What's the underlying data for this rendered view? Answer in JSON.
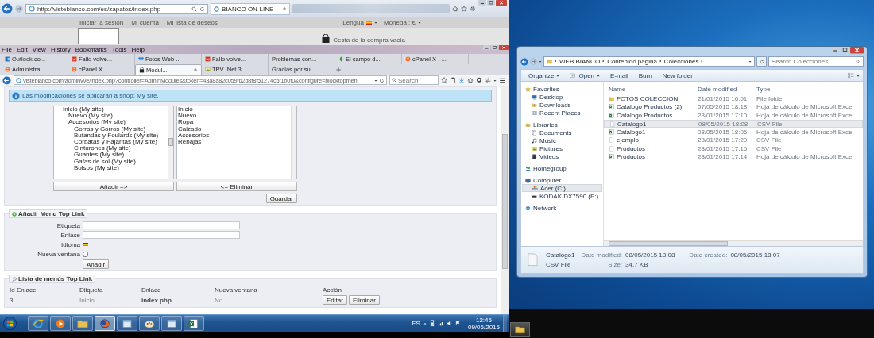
{
  "ie_window": {
    "address": "http://vistebianco.com/es/zapatos/index.php",
    "tab": "BIANCO ON-LINE",
    "links": [
      "Iniciar la sesión",
      "Mi cuenta",
      "Mi lista de deseos"
    ],
    "language_label": "Lengua",
    "currency": "Moneda : €",
    "cart": "Cesta de la compra vacía"
  },
  "firefox": {
    "menu": [
      "File",
      "Edit",
      "View",
      "History",
      "Bookmarks",
      "Tools",
      "Help"
    ],
    "tabs": [
      {
        "label": "Outlook.co...",
        "kind": "mail",
        "selected": false
      },
      {
        "label": "Fallo volve...",
        "kind": "tile",
        "selected": false
      },
      {
        "label": "Fotos Web ...",
        "kind": "box",
        "selected": false
      },
      {
        "label": "Fallo volve...",
        "kind": "tile",
        "selected": false
      },
      {
        "label": "Problemas con...",
        "selected": false
      },
      {
        "label": "El campo d...",
        "kind": "leaf",
        "selected": false
      },
      {
        "label": "cPanel X - ...",
        "kind": "panel",
        "selected": false
      },
      {
        "label": "Administra...",
        "kind": "panel",
        "selected": false
      },
      {
        "label": "cPanel X",
        "kind": "panel",
        "selected": false
      },
      {
        "label": "Modul...",
        "kind": "bag",
        "selected": true
      },
      {
        "label": "TPV .Net 3....",
        "kind": "picture",
        "selected": false
      },
      {
        "label": "Gracias por su ...",
        "selected": false
      }
    ],
    "url": "vistebianco.com/adminvve/index.php?controller=AdminModules&token=43a8a82c059f62d8f8f51274c5f1b0f0&configure=blocktopmen",
    "search_placeholder": "Search"
  },
  "page": {
    "notice": "Las modificaciones se aplicarán a shop: My site.",
    "category_tree": [
      {
        "label": "Inicio (My site)",
        "children": [
          {
            "label": "Nuevo (My site)"
          },
          {
            "label": "Accesorios (My site)",
            "children": [
              {
                "label": "Gorras y Gorros (My site)"
              },
              {
                "label": "Bufandas y Foulards (My site)"
              },
              {
                "label": "Corbatas y Pajaritas (My site)"
              },
              {
                "label": "Cinturones (My site)"
              },
              {
                "label": "Guantes (My site)"
              },
              {
                "label": "Gafas de sol (My site)"
              },
              {
                "label": "Bolsos (My site)"
              }
            ]
          }
        ]
      }
    ],
    "menu_items": [
      "Inicio",
      "Nuevo",
      "Ropa",
      "Calzado",
      "Accesorios",
      "Rebajas"
    ],
    "add_button": "Añadir =>",
    "remove_button": "<= Eliminar",
    "save_button": "Guardar",
    "add_panel": {
      "title": "Añadir Menu Top Link",
      "fields": [
        {
          "label": "Etiqueta",
          "kind": "text"
        },
        {
          "label": "Enlace",
          "kind": "text"
        },
        {
          "label": "Idioma",
          "kind": "flag"
        },
        {
          "label": "Nueva ventana",
          "kind": "checkbox",
          "checked": false
        }
      ],
      "button": "Añadir"
    },
    "list_panel": {
      "title": "Lista de menús Top Link",
      "columns": [
        "Id Enlace",
        "Etiqueta",
        "Enlace",
        "Nueva ventana",
        "Acción"
      ],
      "rows": [
        {
          "cells": [
            "3",
            "Inicio",
            "index.php",
            "No"
          ],
          "actions": [
            "Editar",
            "Eliminar"
          ]
        }
      ]
    }
  },
  "taskbar": {
    "apps": [
      {
        "kind": "ie",
        "selected": false
      },
      {
        "kind": "media",
        "selected": false
      },
      {
        "kind": "folder",
        "selected": false
      },
      {
        "kind": "firefox",
        "selected": true
      },
      {
        "kind": "window",
        "selected": false
      },
      {
        "kind": "paint",
        "selected": false
      },
      {
        "kind": "window",
        "selected": false
      },
      {
        "kind": "excel",
        "selected": false
      }
    ],
    "language": "ES",
    "time": "12:45",
    "date": "09/05/2015"
  },
  "explorer": {
    "path": [
      "WEB BIANCO",
      "Contenido página",
      "Colecciones"
    ],
    "search_placeholder": "Search Colecciones",
    "toolbar": [
      {
        "label": "Organize",
        "kind": "menu"
      },
      {
        "label": "Open",
        "kind": "open"
      },
      {
        "label": "E-mail",
        "kind": "plain"
      },
      {
        "label": "Burn",
        "kind": "plain"
      },
      {
        "label": "New folder",
        "kind": "plain"
      }
    ],
    "nav": [
      {
        "label": "Favorites",
        "kind": "star",
        "selected": false,
        "children": [
          {
            "label": "Desktop",
            "kind": "desktop",
            "selected": false
          },
          {
            "label": "Downloads",
            "kind": "downloads",
            "selected": false
          },
          {
            "label": "Recent Places",
            "kind": "recent",
            "selected": false
          }
        ]
      },
      {
        "label": "Libraries",
        "kind": "library",
        "selected": false,
        "children": [
          {
            "label": "Documents",
            "kind": "document",
            "selected": false
          },
          {
            "label": "Music",
            "kind": "music",
            "selected": false
          },
          {
            "label": "Pictures",
            "kind": "picture",
            "selected": false
          },
          {
            "label": "Videos",
            "kind": "video",
            "selected": false
          }
        ]
      },
      {
        "label": "Homegroup",
        "kind": "homegroup",
        "selected": false
      },
      {
        "label": "Computer",
        "kind": "computer",
        "selected": false,
        "children": [
          {
            "label": "Acer (C:)",
            "kind": "drive",
            "selected": true
          },
          {
            "label": "KODAK DX7590 (E:)",
            "kind": "usb",
            "selected": false
          }
        ]
      },
      {
        "label": "Network",
        "kind": "network",
        "selected": false
      }
    ],
    "columns": [
      "Name",
      "Date modified",
      "Type"
    ],
    "files": [
      {
        "name": "FOTOS COLECCION",
        "date": "21/01/2015 16:01",
        "type": "File folder",
        "kind": "folder",
        "selected": false
      },
      {
        "name": "Catalogo Productos (2)",
        "date": "07/05/2015 18:18",
        "type": "Hoja de cálculo de Microsoft Exce",
        "kind": "sheet",
        "selected": false
      },
      {
        "name": "Catalogo Productos",
        "date": "23/01/2015 17:10",
        "type": "Hoja de cálculo de Microsoft Exce",
        "kind": "sheet",
        "selected": false
      },
      {
        "name": "Catalogo1",
        "date": "08/05/2015 18:08",
        "type": "CSV File",
        "kind": "file",
        "selected": true
      },
      {
        "name": "Catalogo1",
        "date": "08/05/2015 18:06",
        "type": "Hoja de cálculo de Microsoft Exce",
        "kind": "sheet",
        "selected": false
      },
      {
        "name": "ejemplo",
        "date": "23/01/2015 17:20",
        "type": "CSV File",
        "kind": "file",
        "selected": false
      },
      {
        "name": "Productos",
        "date": "23/01/2015 17:15",
        "type": "CSV File",
        "kind": "file",
        "selected": false
      },
      {
        "name": "Productos",
        "date": "23/01/2015 17:14",
        "type": "Hoja de cálculo de Microsoft Exce",
        "kind": "sheet",
        "selected": false
      }
    ],
    "details": {
      "name": "Catalogo1",
      "type": "CSV File",
      "modified_label": "Date modified:",
      "modified": "08/05/2015 18:08",
      "size_label": "Size:",
      "size": "34,7 KB",
      "created_label": "Date created:",
      "created": "08/05/2015 18:07"
    }
  }
}
